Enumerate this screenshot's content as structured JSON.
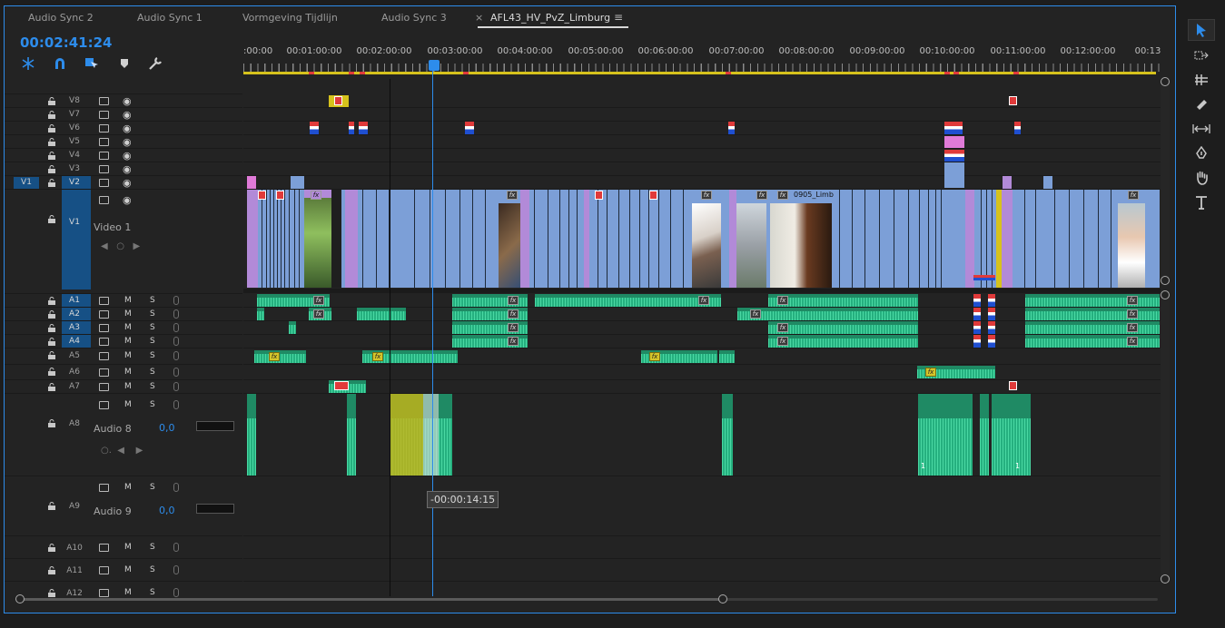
{
  "tabs": [
    {
      "label": "Audio Sync 2",
      "active": false
    },
    {
      "label": "Audio Sync 1",
      "active": false
    },
    {
      "label": "Vormgeving Tijdlijn",
      "active": false
    },
    {
      "label": "Audio Sync 3",
      "active": false
    },
    {
      "label": "AFL43_HV_PvZ_Limburg",
      "active": true
    }
  ],
  "tab_close_glyph": "×",
  "tab_menu_glyph": "≡",
  "timecode": "00:02:41:24",
  "ruler_labels": [
    ":00:00",
    "00:01:00:00",
    "00:02:00:00",
    "00:03:00:00",
    "00:04:00:00",
    "00:05:00:00",
    "00:06:00:00",
    "00:07:00:00",
    "00:08:00:00",
    "00:09:00:00",
    "00:10:00:00",
    "00:11:00:00",
    "00:12:00:00",
    "00:13"
  ],
  "video_tracks": [
    "V8",
    "V7",
    "V6",
    "V5",
    "V4",
    "V3",
    "V2"
  ],
  "v1": {
    "name": "V1",
    "label": "Video 1",
    "source": "V1"
  },
  "audio_tracks_small": [
    "A1",
    "A2",
    "A3",
    "A4",
    "A5",
    "A6",
    "A7"
  ],
  "a8": {
    "name": "A8",
    "label": "Audio 8",
    "volume": "0,0"
  },
  "a9": {
    "name": "A9",
    "label": "Audio 9",
    "volume": "0,0"
  },
  "audio_tracks_bottom": [
    "A10",
    "A11",
    "A12"
  ],
  "mute_label": "M",
  "solo_label": "S",
  "clip_name_v1": "0905_Limb",
  "fx_label": "fx",
  "clip_badge_one": "1",
  "tooltip": "-00:00:14:15",
  "colors": {
    "accent": "#2d8ceb",
    "video_clip": "#7c9fd7",
    "audio_clip": "#2fb58a",
    "work_area": "#d6c21c"
  },
  "toolbar_tools": [
    "selection-tool",
    "track-select-tool",
    "ripple-edit-tool",
    "razor-tool",
    "slip-tool",
    "pen-tool",
    "hand-tool",
    "type-tool"
  ]
}
